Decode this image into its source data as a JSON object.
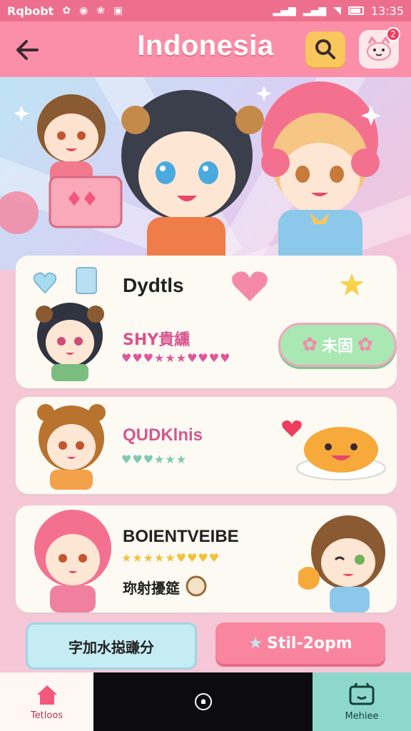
{
  "status_bar": {
    "app_label": "Rqbobt",
    "time": "13:35"
  },
  "header": {
    "title": "Indonesia",
    "notification_count": "2",
    "icons": [
      "back-arrow-icon",
      "search-icon",
      "profile-face-icon"
    ]
  },
  "cards": [
    {
      "title": "Dydtls",
      "subtitle": "SHY貴纁",
      "ratings": "♥♥♥★★★♥♥♥♥",
      "action_label": "未固",
      "icons": [
        "heart-icon",
        "star-icon",
        "blue-cube-icon"
      ]
    },
    {
      "title": "QUDKlnis",
      "ratings": "♥♥♥★★★",
      "icons": [
        "smiling-bun-icon",
        "red-heart-icon"
      ]
    },
    {
      "title": "BOIENTVEIBE",
      "ratings": "★★★★★♥♥♥♥",
      "subtitle": "珎射擾筵",
      "icons": [
        "coin-icon",
        "cookie-icon"
      ]
    }
  ],
  "bottom_buttons": {
    "left_label": "字加水搃豏分",
    "right_label": "Stil-2opm"
  },
  "nav": {
    "home_label": "Tetloos",
    "right_label": "Mehiee"
  },
  "colors": {
    "header_pink": "#fb8ea8",
    "status_pink": "#ee6f8d",
    "search_yellow": "#f9c75d",
    "accent_green": "#a9e7b3",
    "nav_teal": "#8ed8cb"
  }
}
